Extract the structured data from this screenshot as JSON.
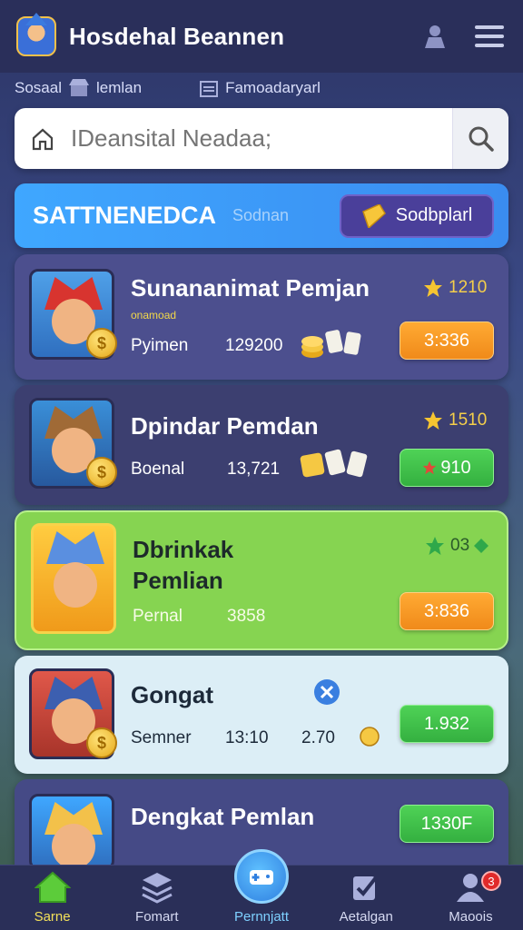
{
  "header": {
    "title": "Hosdehal Beannen"
  },
  "subnav": {
    "items": [
      {
        "label": "Sosaal"
      },
      {
        "label": "lemlan"
      },
      {
        "label": "Famoadaryarl"
      }
    ]
  },
  "search": {
    "placeholder": "IDeansital Neadaa;"
  },
  "banner": {
    "title": "SATTNENEDCA",
    "subtitle": "Sodnan",
    "button_label": "Sodbplarl"
  },
  "cards": [
    {
      "title": "Sunananimat Pemjan",
      "subtitle": "onamoad",
      "label": "Pyimen",
      "value": "129200",
      "rating": "1210",
      "button": "3:336"
    },
    {
      "title": "Dpindar Pemdan",
      "label": "Boenal",
      "value": "13,721",
      "rating": "1510",
      "button": "910"
    },
    {
      "title": "Dbrinkak Pemlian",
      "label": "Pernal",
      "value": "3858",
      "rating": "03",
      "button": "3:836"
    },
    {
      "title": "Gongat",
      "label": "Semner",
      "value": "13:10",
      "value2": "2.70",
      "button": "1.932"
    },
    {
      "title": "Dengkat Pemlan",
      "button": "1330F"
    }
  ],
  "bottomnav": {
    "tabs": [
      {
        "label": "Sarne"
      },
      {
        "label": "Fomart"
      },
      {
        "label": "Pernnjatt"
      },
      {
        "label": "Aetalgan"
      },
      {
        "label": "Maoois",
        "badge": "3"
      }
    ]
  },
  "colors": {
    "accent": "#f3e05a",
    "banner": "#3fa7ff",
    "highlight_card": "#86d451",
    "orange_button": "#f08a1a",
    "green_button": "#34b040"
  }
}
